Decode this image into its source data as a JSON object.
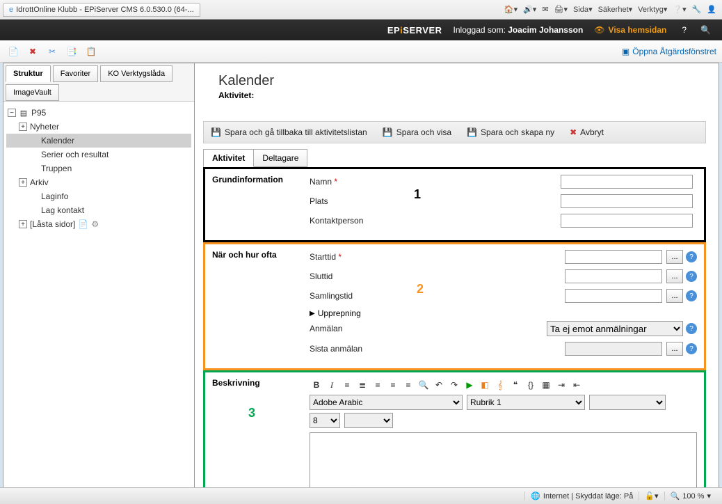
{
  "ie": {
    "tab_title": "IdrottOnline Klubb - EPiServer CMS 6.0.530.0 (64-...",
    "menu": {
      "sida": "Sida",
      "sakerhet": "Säkerhet",
      "verktyg": "Verktyg"
    }
  },
  "epi": {
    "logo": "EPiSERVER",
    "logged_in_prefix": "Inloggad som:",
    "logged_in_user": "Joacim Johansson",
    "view_site": "Visa hemsidan",
    "help": "?",
    "open_actions": "Öppna Åtgärdsfönstret"
  },
  "sidebar_tabs": {
    "struktur": "Struktur",
    "favoriter": "Favoriter",
    "ko": "KO Verktygslåda",
    "imagevault": "ImageVault"
  },
  "tree": {
    "root": "P95",
    "items": [
      {
        "label": "Nyheter",
        "expandable": true
      },
      {
        "label": "Kalender",
        "selected": true
      },
      {
        "label": "Serier och resultat"
      },
      {
        "label": "Truppen"
      },
      {
        "label": "Arkiv",
        "expandable": true
      },
      {
        "label": "Laginfo"
      },
      {
        "label": "Lag kontakt"
      },
      {
        "label": "[Låsta sidor]",
        "expandable": true,
        "extraicons": true
      }
    ]
  },
  "page": {
    "title": "Kalender",
    "subtitle_label": "Aktivitet",
    "subtitle_value": ":"
  },
  "actions": {
    "save_back": "Spara och gå tillbaka till aktivitetslistan",
    "save_view": "Spara och visa",
    "save_new": "Spara och skapa ny",
    "cancel": "Avbryt"
  },
  "tabs": {
    "aktivitet": "Aktivitet",
    "deltagare": "Deltagare"
  },
  "grund": {
    "section": "Grundinformation",
    "namn": "Namn",
    "plats": "Plats",
    "kontakt": "Kontaktperson",
    "marker": "1"
  },
  "naroch": {
    "section": "När och hur ofta",
    "starttid": "Starttid",
    "sluttid": "Sluttid",
    "samlingstid": "Samlingstid",
    "upprepning": "Upprepning",
    "anmalan": "Anmälan",
    "anmalan_value": "Ta ej emot anmälningar",
    "sista": "Sista anmälan",
    "marker": "2"
  },
  "beskrivning": {
    "section": "Beskrivning",
    "font": "Adobe Arabic",
    "style": "Rubrik 1",
    "size": "8",
    "marker": "3"
  },
  "status": {
    "internet": "Internet | Skyddat läge: På",
    "zoom": "100 %"
  }
}
